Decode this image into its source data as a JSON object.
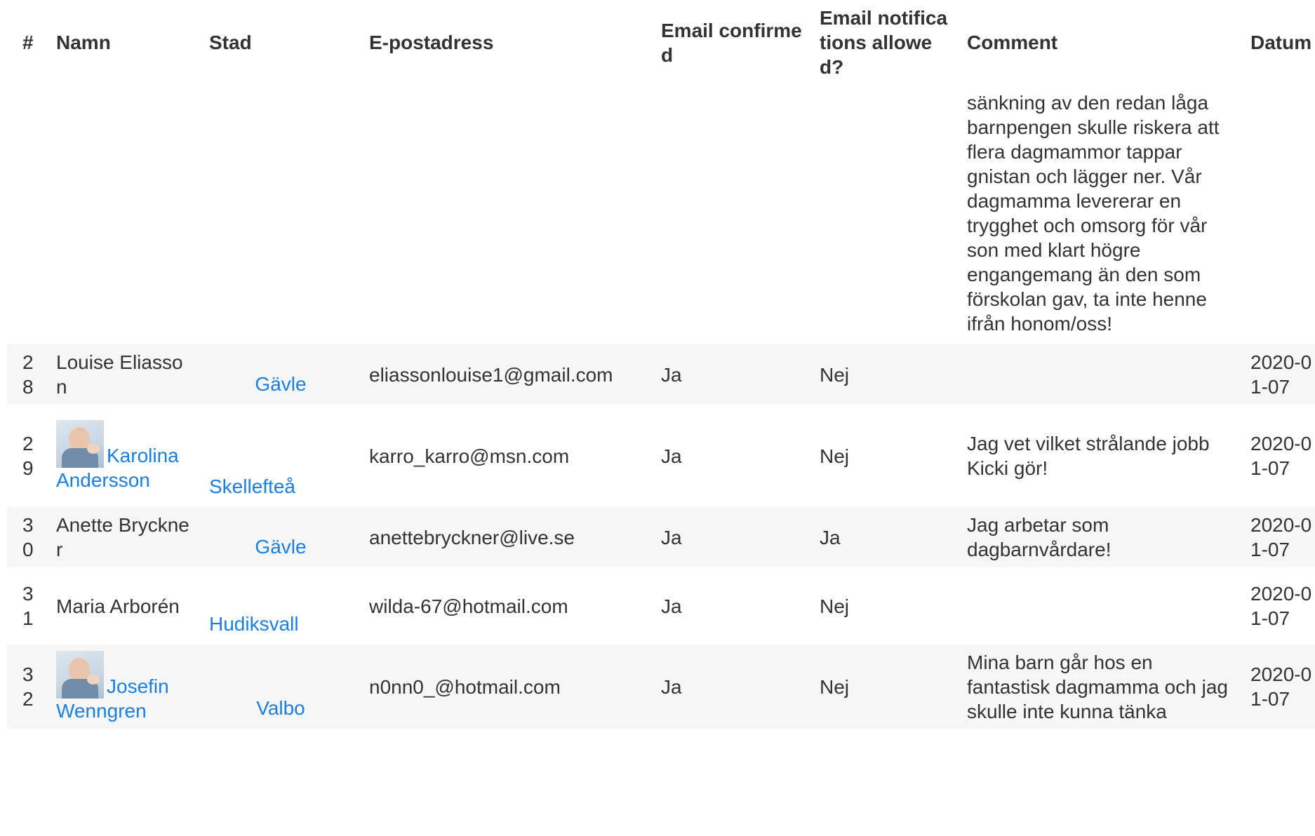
{
  "table": {
    "headers": {
      "num": "#",
      "name": "Namn",
      "city": "Stad",
      "email": "E-postadress",
      "confirmed": "Email confirmed",
      "notifications": "Email notifications allowed?",
      "comment": "Comment",
      "date": "Datum"
    },
    "continued_comment": "sänkning av den redan låga barnpengen skulle riskera att flera dagmammor tappar gnistan och lägger ner. Vår dagmamma levererar en trygghet och omsorg för vår son med klart högre engangemang än den som förskolan gav, ta inte henne ifrån honom/oss!",
    "rows": [
      {
        "num": "28",
        "name": "Louise Eliasson",
        "city": "Gävle",
        "email": "eliassonlouise1@gmail.com",
        "confirmed": "Ja",
        "notifications": "Nej",
        "comment": "",
        "date": "2020-01-07"
      },
      {
        "num": "29",
        "name": "Karolina Andersson",
        "city": "Skellefteå",
        "email": "karro_karro@msn.com",
        "confirmed": "Ja",
        "notifications": "Nej",
        "comment": "Jag vet vilket strålande jobb Kicki gör!",
        "date": "2020-01-07"
      },
      {
        "num": "30",
        "name": "Anette Bryckner",
        "city": "Gävle",
        "email": "anettebryckner@live.se",
        "confirmed": "Ja",
        "notifications": "Ja",
        "comment": "Jag arbetar som dagbarnvårdare!",
        "date": "2020-01-07"
      },
      {
        "num": "31",
        "name": "Maria Arborén",
        "city": "Hudiksvall",
        "email": "wilda-67@hotmail.com",
        "confirmed": "Ja",
        "notifications": "Nej",
        "comment": "",
        "date": "2020-01-07"
      },
      {
        "num": "32",
        "name": "Josefin Wenngren",
        "city": "Valbo",
        "email": "n0nn0_@hotmail.com",
        "confirmed": "Ja",
        "notifications": "Nej",
        "comment": "Mina barn går hos en fantastisk dagmamma och jag skulle inte kunna tänka",
        "date": "2020-01-07"
      }
    ]
  },
  "colors": {
    "link": "#1a7fe3",
    "text": "#333333",
    "stripe": "#f6f6f6"
  },
  "icons": {
    "avatar": "baby-photo-avatar"
  }
}
